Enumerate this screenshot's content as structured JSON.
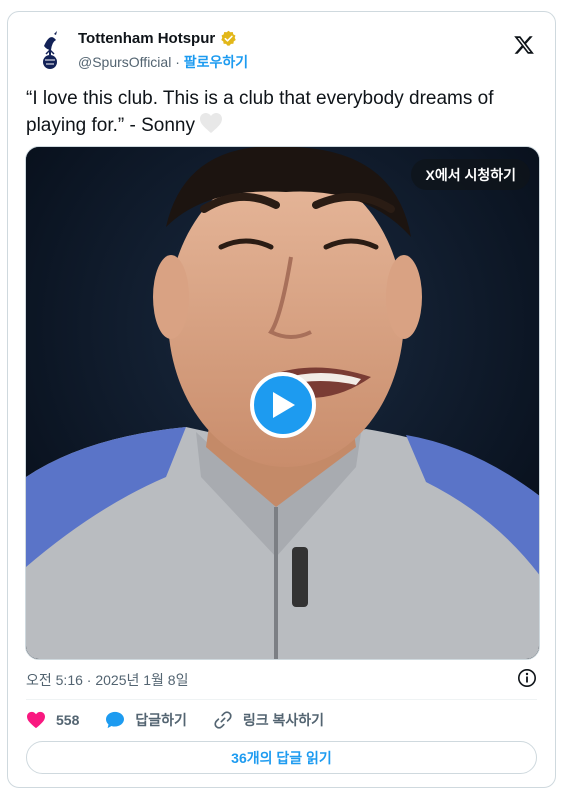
{
  "author": {
    "name": "Tottenham Hotspur",
    "handle": "@SpursOfficial",
    "separator": "·",
    "follow_label": "팔로우하기"
  },
  "tweet": {
    "text": "“I love this club. This is a club that everybody dreams of playing for.” - Sonny"
  },
  "media": {
    "watch_label": "X에서 시청하기"
  },
  "meta": {
    "timestamp": "오전 5:16 · 2025년 1월 8일"
  },
  "actions": {
    "like_count": "558",
    "reply_label": "답글하기",
    "copy_link_label": "링크 복사하기"
  },
  "replies_button": "36개의 답글 읽기",
  "colors": {
    "accent": "#1d9bf0",
    "like": "#f91880",
    "text": "#0f1419",
    "secondary": "#536471",
    "verified": "#e2b719"
  }
}
